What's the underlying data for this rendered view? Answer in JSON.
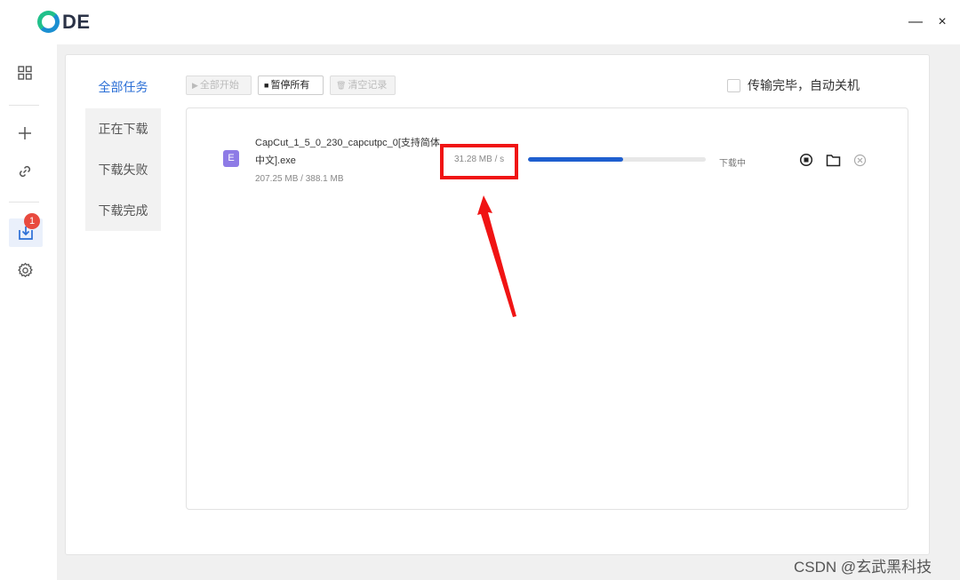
{
  "app": {
    "logo_text": "DE"
  },
  "window": {
    "minimize": "—",
    "close": "×"
  },
  "sidebar": {
    "items": [
      {
        "icon": "grid-icon"
      },
      {
        "icon": "plus-icon"
      },
      {
        "icon": "link-icon"
      },
      {
        "icon": "download-icon",
        "badge": "1"
      },
      {
        "icon": "gear-icon"
      }
    ]
  },
  "categories": {
    "all": "全部任务",
    "downloading": "正在下载",
    "failed": "下载失败",
    "completed": "下载完成"
  },
  "toolbar": {
    "start_all": "全部开始",
    "pause_all": "暂停所有",
    "clear_records": "清空记录"
  },
  "auto_shutdown": {
    "label": "传输完毕，自动关机",
    "checked": false
  },
  "task": {
    "icon_letter": "E",
    "file_name": "CapCut_1_5_0_230_capcutpc_0[支持简体中文].exe",
    "size": "207.25 MB / 388.1 MB",
    "speed": "31.28 MB / s",
    "progress": 0.534,
    "status": "下载中"
  },
  "watermark": "CSDN @玄武黑科技",
  "colors": {
    "accent": "#2b6fd6",
    "progress": "#1f5fcf",
    "highlight": "#f01414",
    "badge": "#e84a3f"
  }
}
